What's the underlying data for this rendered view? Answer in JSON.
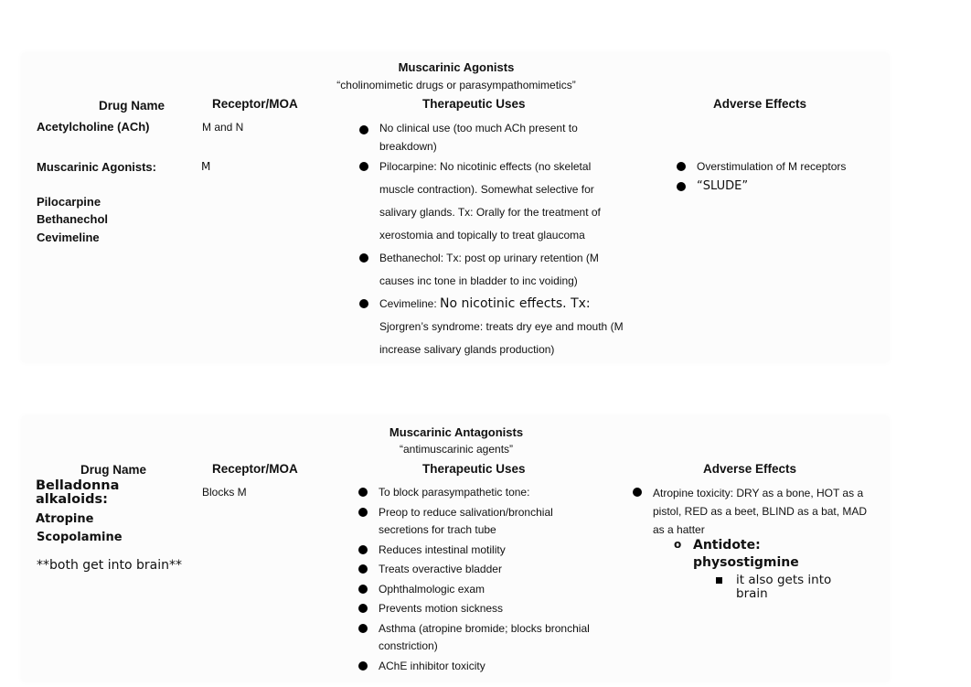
{
  "agonists": {
    "title": "Muscarinic Agonists",
    "subtitle": "“cholinomimetic drugs or parasympathomimetics”",
    "headers": {
      "drug_name": "Drug Name",
      "receptor": "Receptor/MOA",
      "uses": "Therapeutic Uses",
      "adverse": "Adverse Effects"
    },
    "rows": [
      {
        "drug": "Acetylcholine (ACh)",
        "receptor": "M and N",
        "uses": [
          "No clinical use (too much ACh present to breakdown)"
        ]
      },
      {
        "drug_group": "Muscarinic Agonists:",
        "drugs": [
          "Pilocarpine",
          "Bethanechol",
          "Cevimeline"
        ],
        "receptor": "M",
        "uses": [
          "Pilocarpine: No nicotinic effects (no skeletal muscle contraction). Somewhat selective for salivary glands. Tx: Orally for the treatment of xerostomia and topically to treat glaucoma",
          "Bethanechol: Tx: post op urinary retention (M causes inc tone in bladder to inc voiding)"
        ],
        "cevimeline": {
          "prefix": "Cevimeline: ",
          "large": "No nicotinic effects. Tx:",
          "rest": " Sjorgren’s syndrome: treats dry eye and mouth (M increase salivary glands production)"
        },
        "adverse": [
          "Overstimulation of M receptors",
          "“SLUDE”"
        ]
      }
    ]
  },
  "antagonists": {
    "title": "Muscarinic Antagonists",
    "subtitle": "“antimuscarinic agents”",
    "headers": {
      "drug_name": "Drug Name",
      "receptor": "Receptor/MOA",
      "uses": "Therapeutic Uses",
      "adverse": "Adverse Effects"
    },
    "drug_group": "Belladonna alkaloids:",
    "drugs": [
      "Atropine",
      "Scopolamine"
    ],
    "note": "**both get into brain**",
    "receptor": "Blocks M",
    "uses": [
      "To block parasympathetic tone:",
      "Preop to reduce salivation/bronchial secretions for trach tube",
      "Reduces intestinal motility",
      "Treats overactive bladder",
      "Ophthalmologic exam",
      "Prevents motion sickness",
      "Asthma (atropine bromide; blocks bronchial constriction)",
      "AChE inhibitor toxicity"
    ],
    "adverse": {
      "main": "Atropine toxicity: DRY as a bone, HOT as a pistol, RED as a beet, BLIND as a bat, MAD as a hatter",
      "sub_marker": "o",
      "sub": "Antidote: physostigmine",
      "subsub": "it also gets into brain"
    }
  }
}
